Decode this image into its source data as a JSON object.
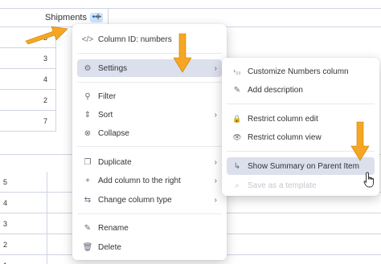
{
  "board": {
    "column_header": "Shipments",
    "dots": "•••",
    "add_column": "+",
    "values_top": [
      "3",
      "3",
      "4",
      "2",
      "7"
    ],
    "values_bottom": [
      "5",
      "4",
      "3",
      "2",
      "1"
    ]
  },
  "main_menu": {
    "items": [
      {
        "icon": "</>",
        "label": "Column ID: numbers"
      },
      {
        "icon": "⚙",
        "label": "Settings",
        "chevron": "›"
      },
      {
        "icon": "⚲",
        "label": "Filter"
      },
      {
        "icon": "⇕",
        "label": "Sort",
        "chevron": "›"
      },
      {
        "icon": "⊗",
        "label": "Collapse"
      },
      {
        "icon": "❐",
        "label": "Duplicate",
        "chevron": "›"
      },
      {
        "icon": "+",
        "label": "Add column to the right",
        "chevron": "›"
      },
      {
        "icon": "⇆",
        "label": "Change column type",
        "chevron": "›"
      },
      {
        "icon": "✎",
        "label": "Rename"
      },
      {
        "icon": "🗑",
        "label": "Delete"
      }
    ]
  },
  "sub_menu": {
    "items": [
      {
        "icon": "¹₂₃",
        "label": "Customize Numbers column"
      },
      {
        "icon": "✎",
        "label": "Add description"
      },
      {
        "icon": "🔒",
        "label": "Restrict column edit"
      },
      {
        "icon": "👁",
        "label": "Restrict column view"
      },
      {
        "icon": "↳",
        "label": "Show Summary on Parent Item"
      },
      {
        "icon": "⌕",
        "label": "Save as a template"
      }
    ]
  },
  "colors": {
    "accent_arrow": "#f5a623",
    "active_bg": "#dcdfec",
    "dots_bg": "#cce5ff"
  }
}
